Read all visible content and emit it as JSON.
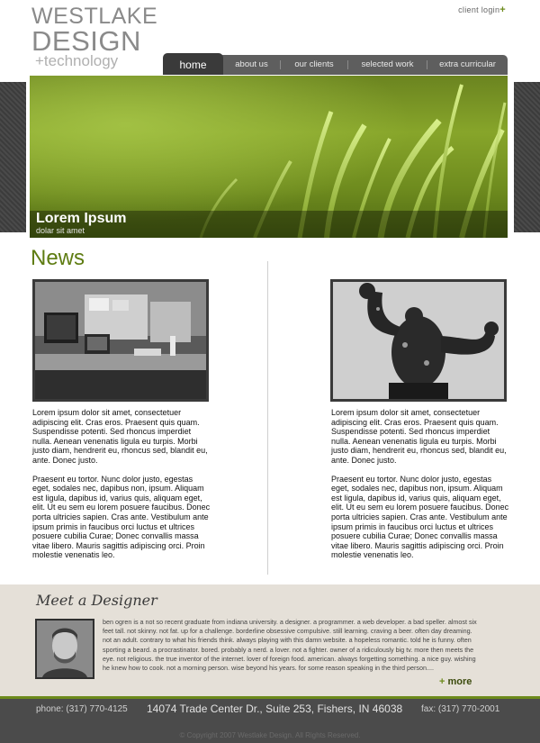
{
  "brand": {
    "line1": "WESTLAKE",
    "line2": "DESIGN",
    "line3": "+technology"
  },
  "header": {
    "client_login": "client login",
    "client_login_icon": "plus"
  },
  "nav": {
    "items": [
      {
        "label": "home",
        "active": true
      },
      {
        "label": "about us",
        "active": false
      },
      {
        "label": "our clients",
        "active": false
      },
      {
        "label": "selected work",
        "active": false
      },
      {
        "label": "extra curricular",
        "active": false
      }
    ]
  },
  "hero": {
    "title": "Lorem Ipsum",
    "subtitle": "dolar sit amet"
  },
  "news": {
    "heading": "News",
    "articles": [
      {
        "image": "office-desk-photo",
        "p1": "Lorem ipsum dolor sit amet, consectetuer adipiscing elit. Cras eros. Praesent quis quam. Suspendisse potenti. Sed rhoncus imperdiet nulla. Aenean venenatis ligula eu turpis. Morbi justo diam, hendrerit eu, rhoncus sed, blandit eu, ante. Donec justo.",
        "p2": "Praesent eu tortor. Nunc dolor justo, egestas eget, sodales nec, dapibus non, ipsum. Aliquam est ligula, dapibus id, varius quis, aliquam eget, elit. Ut eu sem eu lorem posuere faucibus. Donec porta ultricies sapien. Cras ante. Vestibulum ante ipsum primis in faucibus orci luctus et ultrices posuere cubilia Curae; Donec convallis massa vitae libero. Mauris sagittis adipiscing orci. Proin molestie venenatis leo."
      },
      {
        "image": "muscle-statue-photo",
        "p1": "Lorem ipsum dolor sit amet, consectetuer adipiscing elit. Cras eros. Praesent quis quam. Suspendisse potenti. Sed rhoncus imperdiet nulla. Aenean venenatis ligula eu turpis. Morbi justo diam, hendrerit eu, rhoncus sed, blandit eu, ante. Donec justo.",
        "p2": "Praesent eu tortor. Nunc dolor justo, egestas eget, sodales nec, dapibus non, ipsum. Aliquam est ligula, dapibus id, varius quis, aliquam eget, elit. Ut eu sem eu lorem posuere faucibus. Donec porta ultricies sapien. Cras ante. Vestibulum ante ipsum primis in faucibus orci luctus et ultrices posuere cubilia Curae; Donec convallis massa vitae libero. Mauris sagittis adipiscing orci. Proin molestie venenatis leo."
      }
    ]
  },
  "designer": {
    "heading": "Meet a Designer",
    "bio": "ben ogren is a  not so recent graduate from indiana university. a designer. a programmer. a web developer. a bad speller. almost six feet tall. not skinny. not fat. up for a challenge. borderline obsessive compulsive. still learning. craving a beer. often day dreaming. not an adult. contrary to what his friends think. always playing with this damn website. a hopeless romantic. told he is funny. often sporting a beard. a procrastinator. bored. probably a nerd. a lover. not a fighter. owner of a ridiculously big tv. more then meets the eye. not religious. the true inventor of the internet. lover of foreign food. american. always forgetting something. a nice guy. wishing he knew how to cook. not a morning person. wise beyond his years. for some reason speaking in the third person....",
    "more_label": "more",
    "more_icon": "plus"
  },
  "footer": {
    "phone": "phone: (317) 770-4125",
    "address": "14074 Trade Center Dr.,  Suite 253,  Fishers, IN 46038",
    "fax": "fax: (317) 770-2001",
    "copyright": "© Copyright 2007 Westlake Design. All Rights Reserved."
  },
  "colors": {
    "accent_green": "#6d8b1c",
    "news_heading": "#5e7c12",
    "nav_bg": "#5e5e5e",
    "footer_bg": "#4b4b4b",
    "meet_bg": "#e5e0d8"
  }
}
